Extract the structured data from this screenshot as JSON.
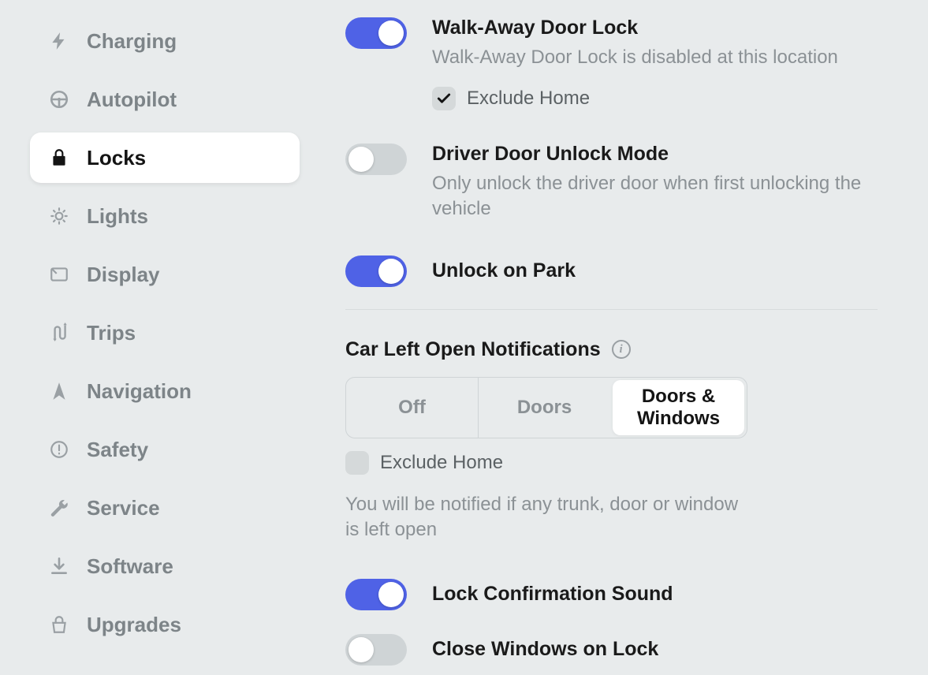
{
  "sidebar": {
    "items": [
      {
        "id": "charging",
        "label": "Charging",
        "icon": "bolt-icon",
        "active": false
      },
      {
        "id": "autopilot",
        "label": "Autopilot",
        "icon": "steering-icon",
        "active": false
      },
      {
        "id": "locks",
        "label": "Locks",
        "icon": "lock-icon",
        "active": true
      },
      {
        "id": "lights",
        "label": "Lights",
        "icon": "lightbulb-icon",
        "active": false
      },
      {
        "id": "display",
        "label": "Display",
        "icon": "display-icon",
        "active": false
      },
      {
        "id": "trips",
        "label": "Trips",
        "icon": "route-icon",
        "active": false
      },
      {
        "id": "navigation",
        "label": "Navigation",
        "icon": "navigation-icon",
        "active": false
      },
      {
        "id": "safety",
        "label": "Safety",
        "icon": "warning-icon",
        "active": false
      },
      {
        "id": "service",
        "label": "Service",
        "icon": "wrench-icon",
        "active": false
      },
      {
        "id": "software",
        "label": "Software",
        "icon": "download-icon",
        "active": false
      },
      {
        "id": "upgrades",
        "label": "Upgrades",
        "icon": "upgrade-icon",
        "active": false
      }
    ]
  },
  "settings": {
    "walkAway": {
      "title": "Walk-Away Door Lock",
      "desc": "Walk-Away Door Lock is disabled at this location",
      "enabled": true,
      "excludeHomeLabel": "Exclude Home",
      "excludeHomeChecked": true
    },
    "driverDoor": {
      "title": "Driver Door Unlock Mode",
      "desc": "Only unlock the driver door when first unlocking the vehicle",
      "enabled": false
    },
    "unlockOnPark": {
      "title": "Unlock on Park",
      "enabled": true
    },
    "carLeftOpen": {
      "title": "Car Left Open Notifications",
      "options": [
        "Off",
        "Doors",
        "Doors & Windows"
      ],
      "selectedIndex": 2,
      "excludeHomeLabel": "Exclude Home",
      "excludeHomeChecked": false,
      "note": "You will be notified if any trunk, door or window is left open"
    },
    "lockSound": {
      "title": "Lock Confirmation Sound",
      "enabled": true
    },
    "closeWindows": {
      "title": "Close Windows on Lock",
      "enabled": false
    }
  },
  "colors": {
    "accent": "#4f62e6",
    "textPrimary": "#1a1a1a",
    "textSecondary": "#8b9195",
    "background": "#e8ebec"
  }
}
